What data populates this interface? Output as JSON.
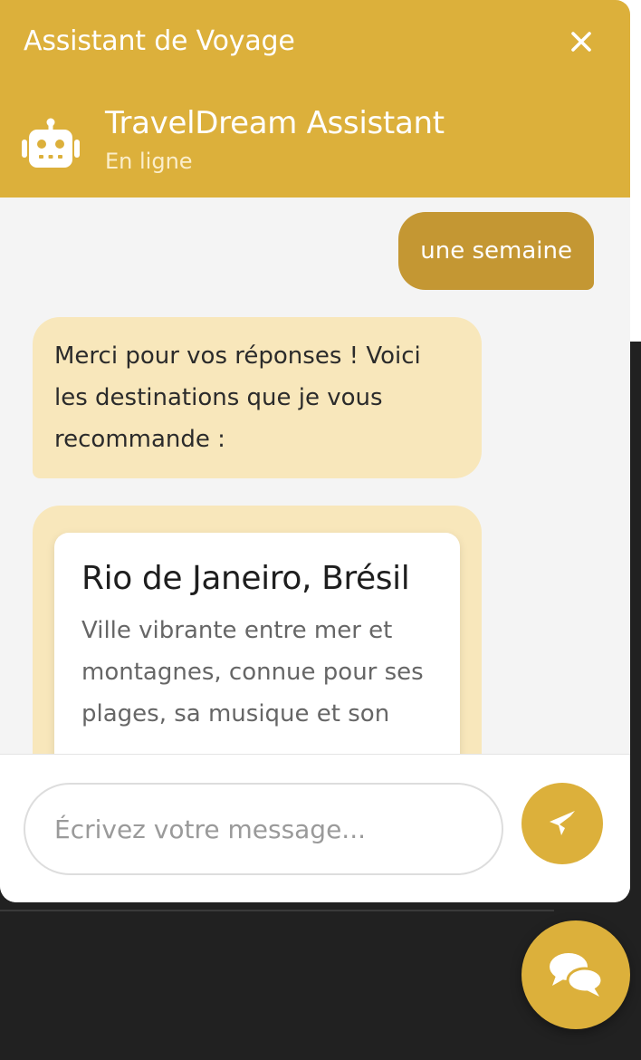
{
  "colors": {
    "accent": "#dcb03b",
    "user_bubble": "#c49733",
    "bot_bubble": "#f8e7bb",
    "page_dark": "#212121"
  },
  "header": {
    "title": "Assistant de Voyage",
    "close_icon": "close-icon",
    "bot_icon": "robot-icon",
    "bot_name": "TravelDream Assistant",
    "status": "En ligne"
  },
  "messages": {
    "user_reply": "une semaine",
    "bot_reply": "Merci pour vos réponses ! Voici les destinations que je vous recommande :",
    "recommendation": {
      "name": "Rio de Janeiro, Brésil",
      "description": "Ville vibrante entre mer et montagnes, connue pour ses plages, sa musique et son"
    }
  },
  "input": {
    "placeholder": "Écrivez votre message...",
    "value": "",
    "send_icon": "paper-plane-icon"
  },
  "launcher": {
    "icon": "chat-bubbles-icon"
  }
}
